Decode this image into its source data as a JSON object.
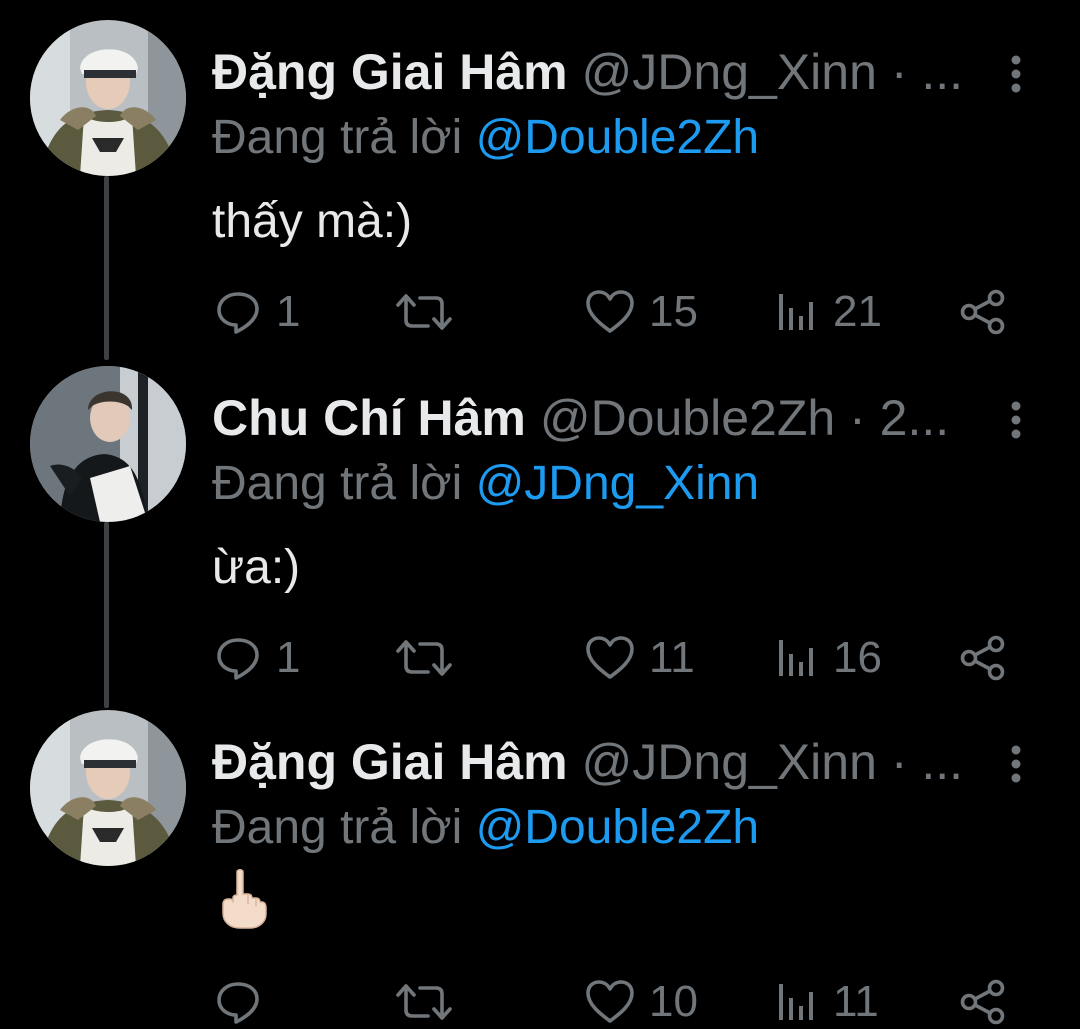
{
  "colors": {
    "background": "#000000",
    "text_primary": "#e7e9ea",
    "text_secondary": "#71767b",
    "link": "#1d9bf0",
    "thread_line": "#3e4144"
  },
  "tweets": [
    {
      "display_name": "Đặng Giai Hâm",
      "handle": "@JDng_Xinn",
      "dot": "·",
      "time": "...",
      "reply_prefix": "Đang trả lời ",
      "reply_target": "@Double2Zh",
      "text": "thấy mà:)",
      "avatar": "avatar-jdng-xinn",
      "counts": {
        "reply": "1",
        "retweet": "",
        "like": "15",
        "views": "21"
      }
    },
    {
      "display_name": "Chu Chí Hâm",
      "handle": "@Double2Zh",
      "dot": "·",
      "time": "2...",
      "reply_prefix": "Đang trả lời ",
      "reply_target": "@JDng_Xinn",
      "text": "ừa:)",
      "avatar": "avatar-double2zh",
      "counts": {
        "reply": "1",
        "retweet": "",
        "like": "11",
        "views": "16"
      }
    },
    {
      "display_name": "Đặng Giai Hâm",
      "handle": "@JDng_Xinn",
      "dot": "·",
      "time": "...",
      "reply_prefix": "Đang trả lời ",
      "reply_target": "@Double2Zh",
      "text": "",
      "emoji": "middle-finger-emoji",
      "avatar": "avatar-jdng-xinn",
      "counts": {
        "reply": "",
        "retweet": "",
        "like": "10",
        "views": "11"
      }
    }
  ],
  "icons": {
    "reply": "reply-icon",
    "retweet": "retweet-icon",
    "like": "heart-icon",
    "views": "views-icon",
    "share": "share-icon",
    "more": "more-vertical-icon"
  }
}
